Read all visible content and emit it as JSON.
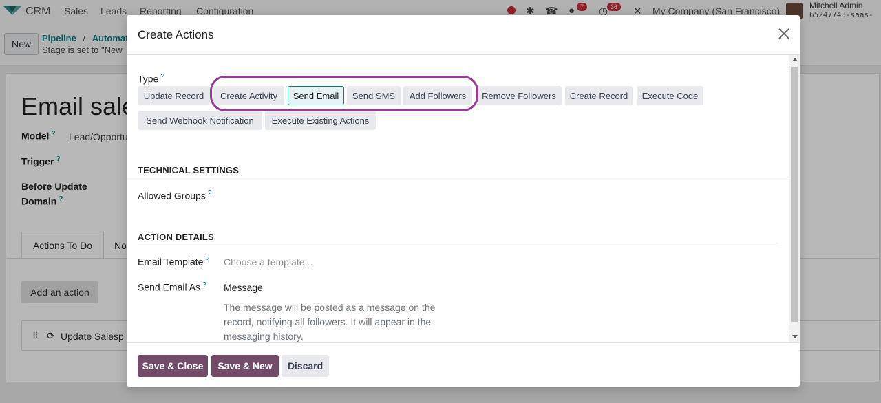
{
  "navbar": {
    "app_name": "CRM",
    "menu": [
      "Sales",
      "Leads",
      "Reporting",
      "Configuration"
    ],
    "messages_badge": "7",
    "activities_badge": "36",
    "company": "My Company (San Francisco)",
    "user_name": "Mitchell Admin",
    "user_db": "65247743-saas-"
  },
  "control_panel": {
    "new_label": "New",
    "breadcrumb_root": "Pipeline",
    "breadcrumb_sep": "/",
    "breadcrumb_current": "Automati",
    "subtitle": "Stage is set to \"New"
  },
  "background_form": {
    "title": "Email sales",
    "model_label": "Model",
    "model_value": "Lead/Opportu",
    "trigger_label": "Trigger",
    "before_update_label": "Before Update",
    "domain_label": "Domain",
    "tab_actions": "Actions To Do",
    "tab_other": "No",
    "add_action": "Add an action",
    "row_text": "Update Salesp"
  },
  "modal": {
    "title": "Create Actions",
    "type_label": "Type",
    "help_mark": "?",
    "types": [
      {
        "label": "Update Record",
        "selected": false
      },
      {
        "label": "Create Activity",
        "selected": false
      },
      {
        "label": "Send Email",
        "selected": true
      },
      {
        "label": "Send SMS",
        "selected": false
      },
      {
        "label": "Add Followers",
        "selected": false
      },
      {
        "label": "Remove Followers",
        "selected": false
      },
      {
        "label": "Create Record",
        "selected": false
      },
      {
        "label": "Execute Code",
        "selected": false
      },
      {
        "label": "Send Webhook Notification",
        "selected": false
      },
      {
        "label": "Execute Existing Actions",
        "selected": false
      }
    ],
    "technical_settings": "TECHNICAL SETTINGS",
    "allowed_groups_label": "Allowed Groups",
    "action_details": "ACTION DETAILS",
    "email_template_label": "Email Template",
    "email_template_placeholder": "Choose a template...",
    "send_email_as_label": "Send Email As",
    "send_email_as_value": "Message",
    "send_email_as_desc": "The message will be posted as a message on the record, notifying all followers. It will appear in the messaging history."
  },
  "footer": {
    "save_close": "Save & Close",
    "save_new": "Save & New",
    "discard": "Discard"
  },
  "colors": {
    "primary": "#714b67",
    "accent": "#017e84",
    "highlight": "#9a3b9b"
  }
}
